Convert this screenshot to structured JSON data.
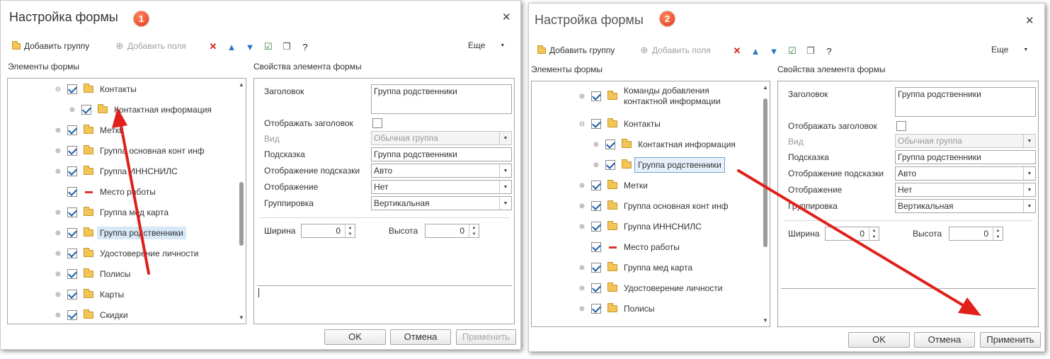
{
  "colors": {
    "accent_arrow": "#e0201a",
    "checkbox": "#1c5ea8",
    "selection": "#d7e8f7",
    "folder": "#f2c556"
  },
  "dialog1": {
    "title": "Настройка формы",
    "badge": "1",
    "toolbar": {
      "add_group": "Добавить группу",
      "add_fields": "Добавить поля",
      "more": "Еще"
    },
    "tree_heading": "Элементы формы",
    "props_heading": "Свойства элемента формы",
    "tree": [
      {
        "label": "Контакты",
        "expander": "⊖",
        "level": 0,
        "icon": "folder-icon"
      },
      {
        "label": "Контактная информация",
        "expander": "⊕",
        "level": 1,
        "icon": "folder-icon"
      },
      {
        "label": "Метки",
        "expander": "⊕",
        "level": 0,
        "icon": "folder-icon"
      },
      {
        "label": "Группа основная конт инф",
        "expander": "⊕",
        "level": 0,
        "icon": "folder-icon"
      },
      {
        "label": "Группа ИННСНИЛС",
        "expander": "⊕",
        "level": 0,
        "icon": "folder-icon"
      },
      {
        "label": "Место работы",
        "expander": "",
        "level": 0,
        "icon": "field-dash-icon"
      },
      {
        "label": "Группа мед карта",
        "expander": "⊕",
        "level": 0,
        "icon": "folder-icon"
      },
      {
        "label": "Группа родственники",
        "expander": "⊕",
        "level": 0,
        "icon": "folder-icon",
        "selected": true
      },
      {
        "label": "Удостоверение личности",
        "expander": "⊕",
        "level": 0,
        "icon": "folder-icon"
      },
      {
        "label": "Полисы",
        "expander": "⊕",
        "level": 0,
        "icon": "folder-icon"
      },
      {
        "label": "Карты",
        "expander": "⊕",
        "level": 0,
        "icon": "folder-icon"
      },
      {
        "label": "Скидки",
        "expander": "⊕",
        "level": 0,
        "icon": "folder-icon"
      }
    ],
    "props": {
      "title_label": "Заголовок",
      "title_value": "Группа родственники",
      "show_title_label": "Отображать заголовок",
      "kind_label": "Вид",
      "kind_value": "Обычная группа",
      "hint_label": "Подсказка",
      "hint_value": "Группа родственники",
      "hint_display_label": "Отображение подсказки",
      "hint_display_value": "Авто",
      "display_label": "Отображение",
      "display_value": "Нет",
      "grouping_label": "Группировка",
      "grouping_value": "Вертикальная",
      "width_label": "Ширина",
      "width_value": "0",
      "height_label": "Высота",
      "height_value": "0"
    },
    "buttons": {
      "ok": "OK",
      "cancel": "Отмена",
      "apply": "Применить"
    }
  },
  "dialog2": {
    "title": "Настройка формы",
    "badge": "2",
    "toolbar": {
      "add_group": "Добавить группу",
      "add_fields": "Добавить поля",
      "more": "Еще"
    },
    "tree_heading": "Элементы формы",
    "props_heading": "Свойства элемента формы",
    "tree": [
      {
        "label": "Команды добавления",
        "label2": "контактной информации",
        "expander": "⊕",
        "level": 0,
        "icon": "folder-icon"
      },
      {
        "label": "Контакты",
        "expander": "⊖",
        "level": 0,
        "icon": "folder-icon"
      },
      {
        "label": "Контактная информация",
        "expander": "⊕",
        "level": 1,
        "icon": "folder-icon"
      },
      {
        "label": "Группа родственники",
        "expander": "⊕",
        "level": 1,
        "icon": "folder-icon",
        "selected": true
      },
      {
        "label": "Метки",
        "expander": "⊕",
        "level": 0,
        "icon": "folder-icon"
      },
      {
        "label": "Группа основная конт инф",
        "expander": "⊕",
        "level": 0,
        "icon": "folder-icon"
      },
      {
        "label": "Группа ИННСНИЛС",
        "expander": "⊕",
        "level": 0,
        "icon": "folder-icon"
      },
      {
        "label": "Место работы",
        "expander": "",
        "level": 0,
        "icon": "field-dash-icon"
      },
      {
        "label": "Группа мед карта",
        "expander": "⊕",
        "level": 0,
        "icon": "folder-icon"
      },
      {
        "label": "Удостоверение личности",
        "expander": "⊕",
        "level": 0,
        "icon": "folder-icon"
      },
      {
        "label": "Полисы",
        "expander": "⊕",
        "level": 0,
        "icon": "folder-icon"
      }
    ],
    "props": {
      "title_label": "Заголовок",
      "title_value": "Группа родственники",
      "show_title_label": "Отображать заголовок",
      "kind_label": "Вид",
      "kind_value": "Обычная группа",
      "hint_label": "Подсказка",
      "hint_value": "Группа родственники",
      "hint_display_label": "Отображение подсказки",
      "hint_display_value": "Авто",
      "display_label": "Отображение",
      "display_value": "Нет",
      "grouping_label": "Группировка",
      "grouping_value": "Вертикальная",
      "width_label": "Ширина",
      "width_value": "0",
      "height_label": "Высота",
      "height_value": "0"
    },
    "buttons": {
      "ok": "OK",
      "cancel": "Отмена",
      "apply": "Применить"
    }
  }
}
